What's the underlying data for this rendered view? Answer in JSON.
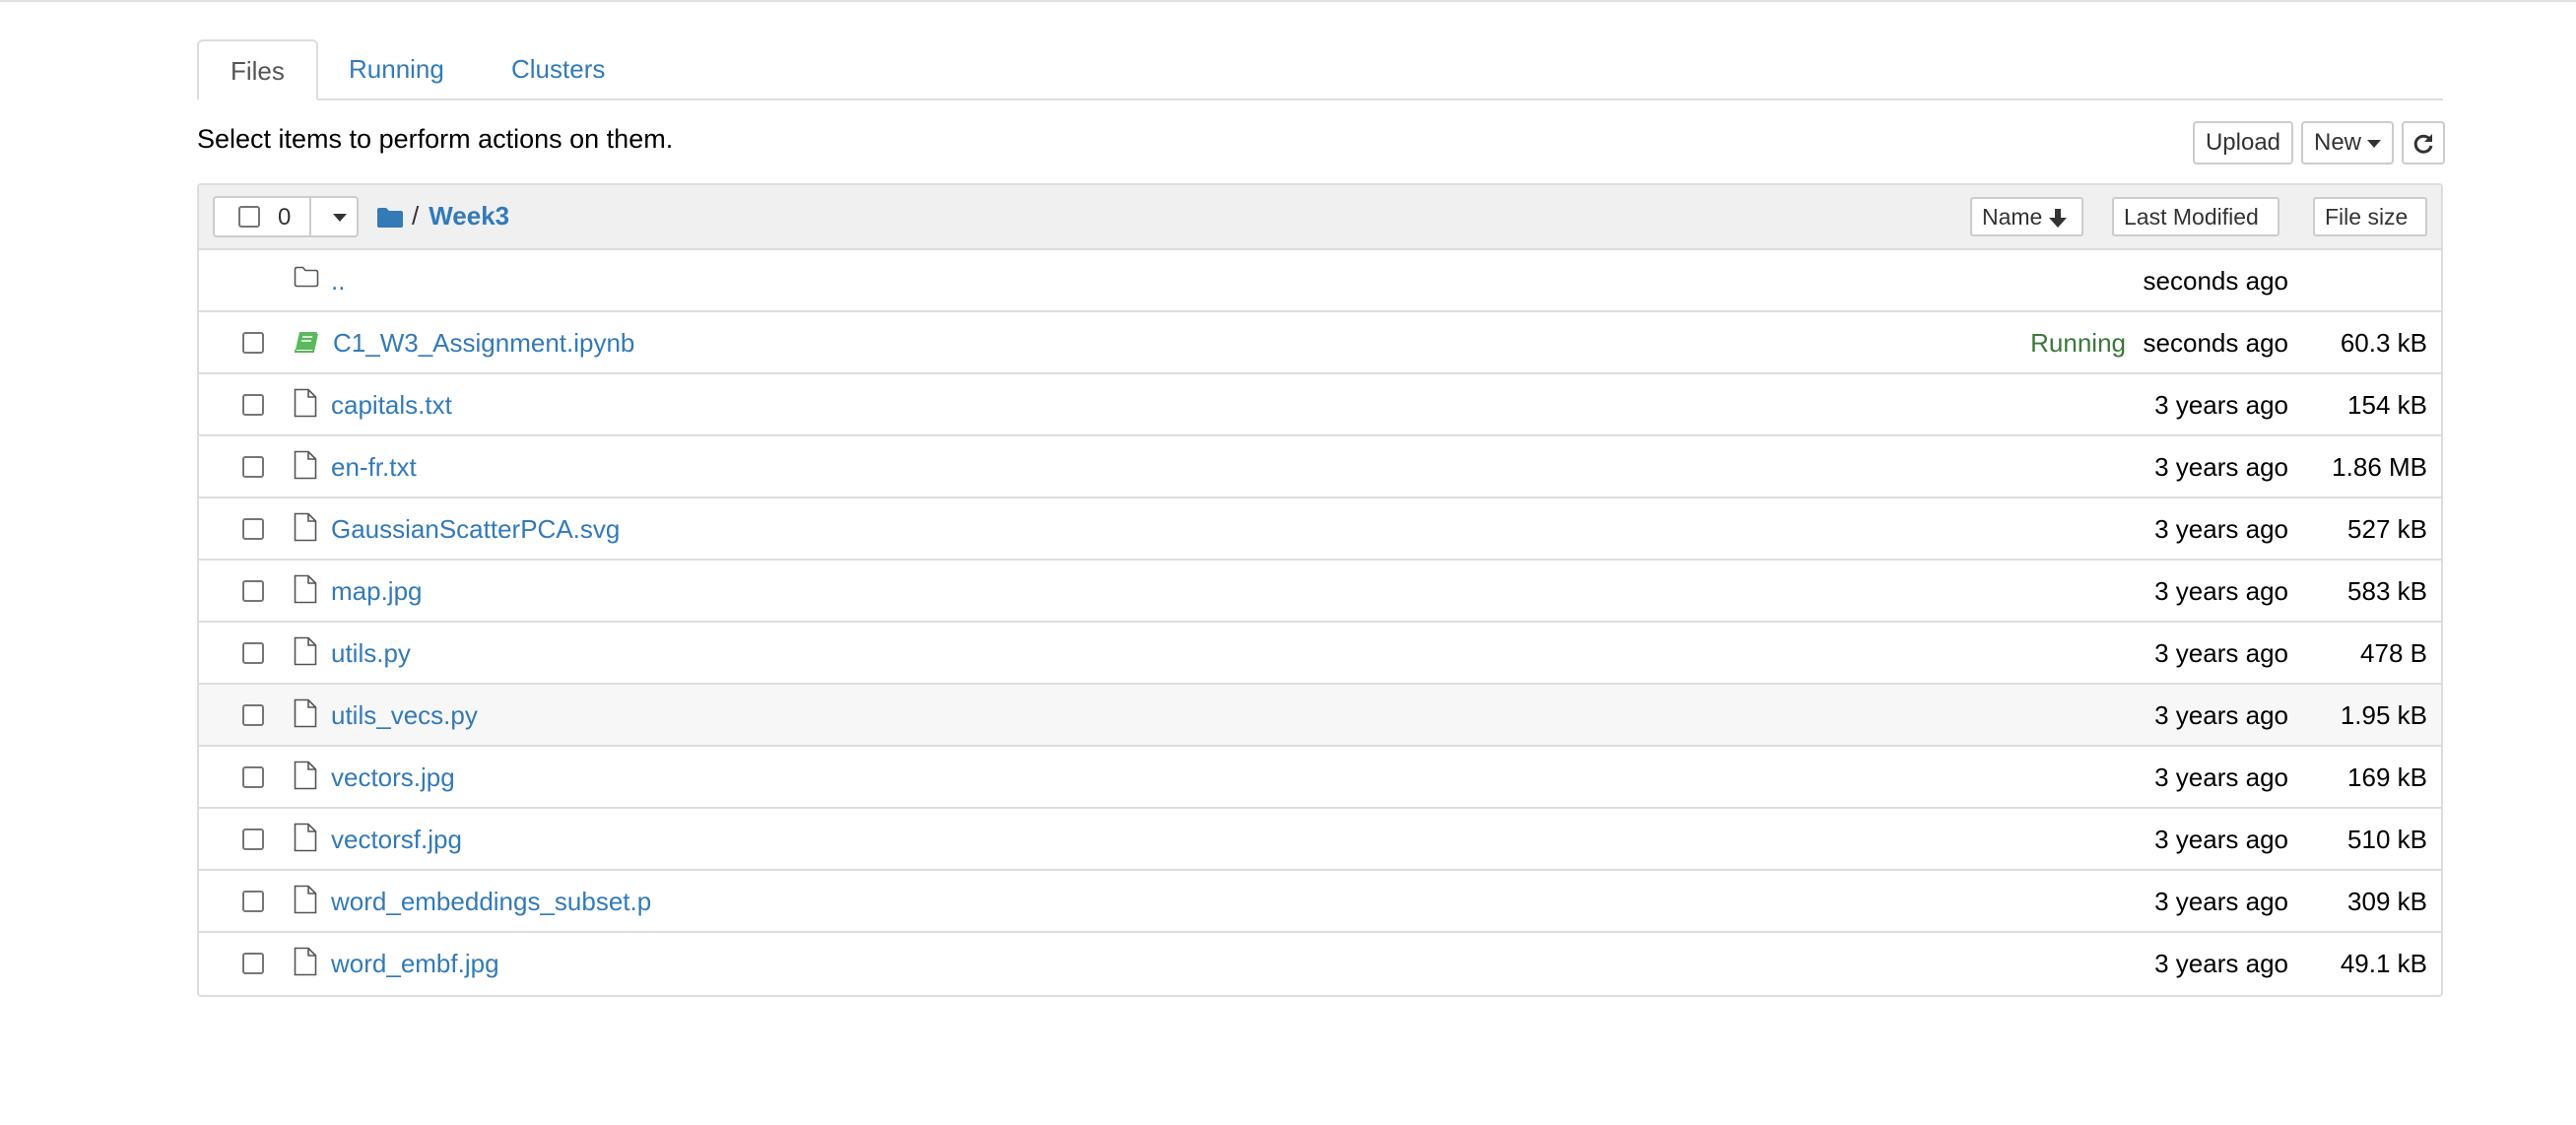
{
  "tabs": {
    "files": "Files",
    "running": "Running",
    "clusters": "Clusters"
  },
  "toolbar": {
    "hint": "Select items to perform actions on them.",
    "upload_label": "Upload",
    "new_label": "New",
    "refresh_icon": "refresh-icon"
  },
  "list_header": {
    "selected_count": "0",
    "breadcrumb_sep": "/",
    "current_folder": "Week3",
    "sort_name": "Name",
    "sort_modified": "Last Modified",
    "sort_size": "File size"
  },
  "colors": {
    "link": "#337ab7",
    "running": "#3c763d",
    "notebook_icon": "#5cb85c"
  },
  "files": [
    {
      "name": "..",
      "type": "parent",
      "status": "",
      "modified": "seconds ago",
      "size": ""
    },
    {
      "name": "C1_W3_Assignment.ipynb",
      "type": "notebook",
      "status": "Running",
      "modified": "seconds ago",
      "size": "60.3 kB"
    },
    {
      "name": "capitals.txt",
      "type": "file",
      "status": "",
      "modified": "3 years ago",
      "size": "154 kB"
    },
    {
      "name": "en-fr.txt",
      "type": "file",
      "status": "",
      "modified": "3 years ago",
      "size": "1.86 MB"
    },
    {
      "name": "GaussianScatterPCA.svg",
      "type": "file",
      "status": "",
      "modified": "3 years ago",
      "size": "527 kB"
    },
    {
      "name": "map.jpg",
      "type": "file",
      "status": "",
      "modified": "3 years ago",
      "size": "583 kB"
    },
    {
      "name": "utils.py",
      "type": "file",
      "status": "",
      "modified": "3 years ago",
      "size": "478 B"
    },
    {
      "name": "utils_vecs.py",
      "type": "file",
      "status": "",
      "modified": "3 years ago",
      "size": "1.95 kB"
    },
    {
      "name": "vectors.jpg",
      "type": "file",
      "status": "",
      "modified": "3 years ago",
      "size": "169 kB"
    },
    {
      "name": "vectorsf.jpg",
      "type": "file",
      "status": "",
      "modified": "3 years ago",
      "size": "510 kB"
    },
    {
      "name": "word_embeddings_subset.p",
      "type": "file",
      "status": "",
      "modified": "3 years ago",
      "size": "309 kB"
    },
    {
      "name": "word_embf.jpg",
      "type": "file",
      "status": "",
      "modified": "3 years ago",
      "size": "49.1 kB"
    }
  ]
}
